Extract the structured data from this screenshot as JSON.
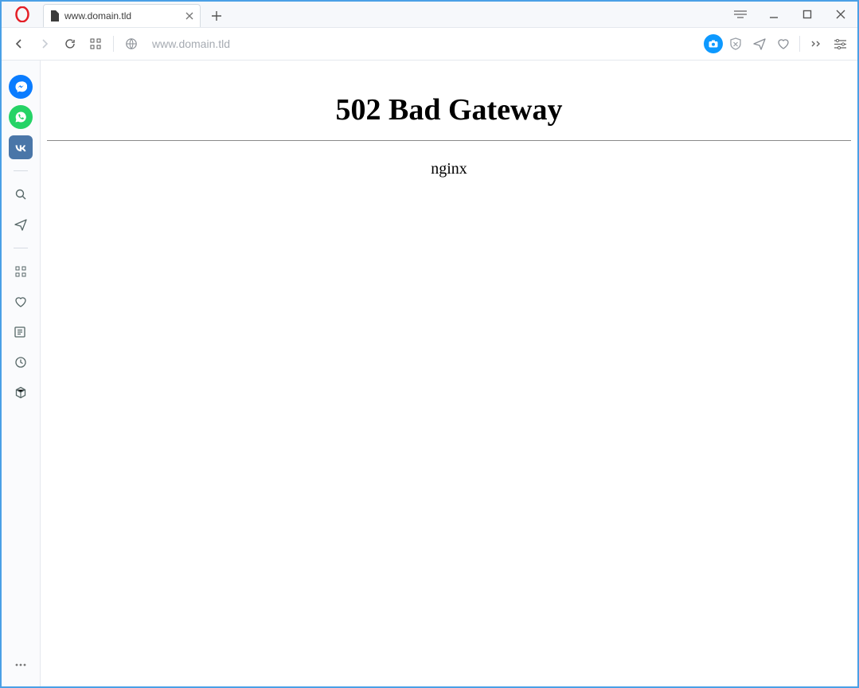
{
  "tab": {
    "title": "www.domain.tld"
  },
  "address": {
    "value": "www.domain.tld"
  },
  "page": {
    "heading": "502 Bad Gateway",
    "server": "nginx"
  }
}
